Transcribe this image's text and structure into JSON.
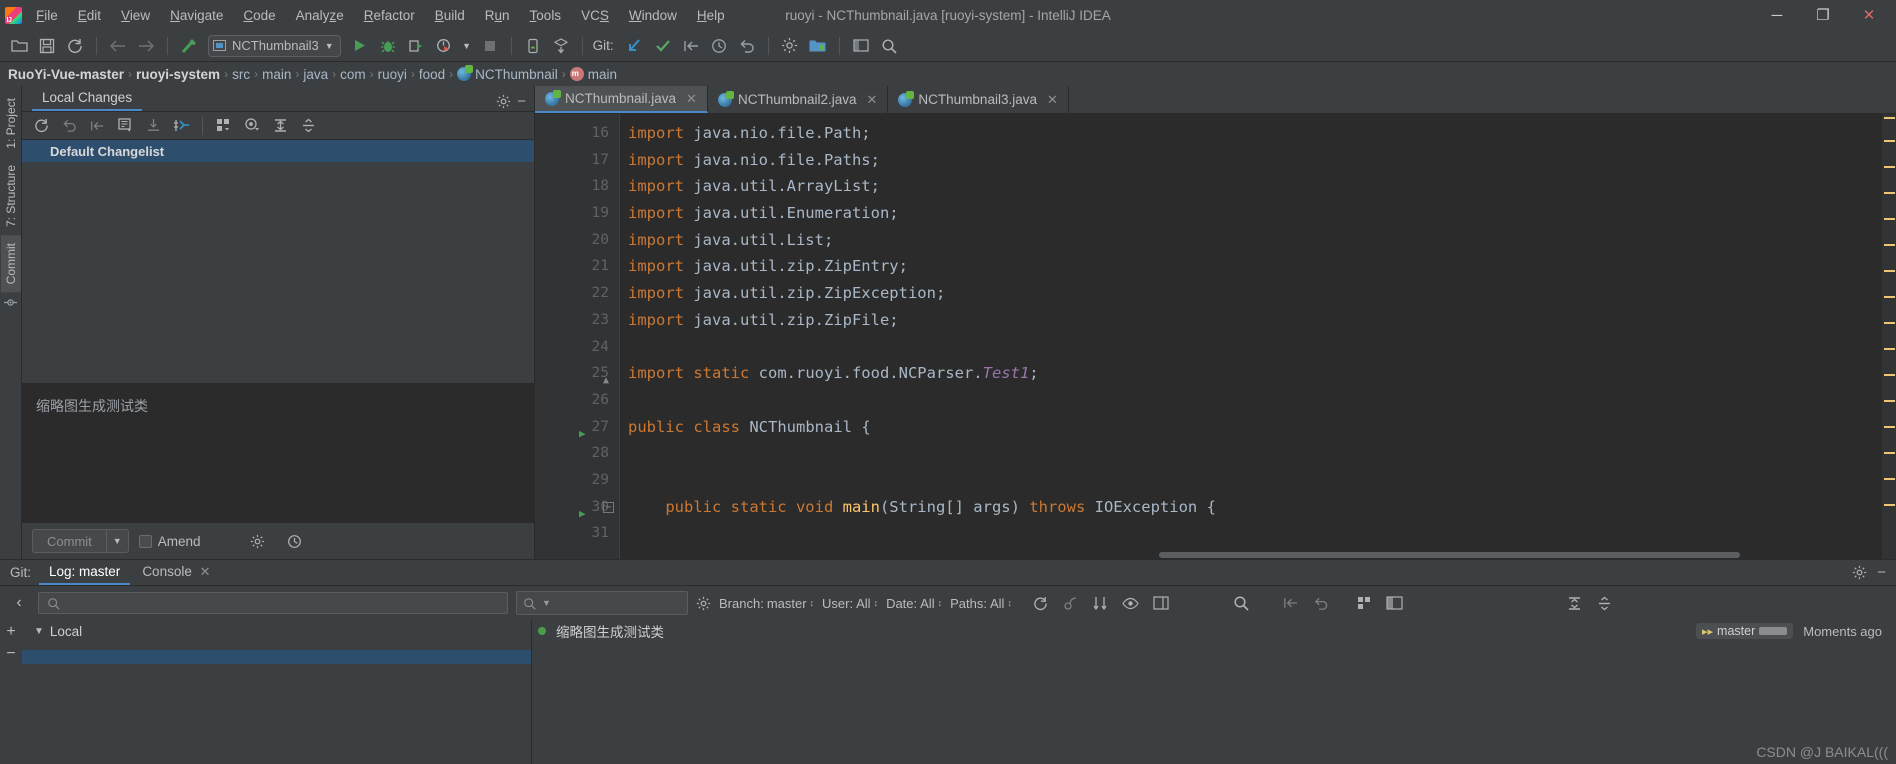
{
  "window": {
    "title": "ruoyi - NCThumbnail.java [ruoyi-system] - IntelliJ IDEA",
    "minimize": "─",
    "maximize": "❐",
    "close": "✕"
  },
  "menu": {
    "items": [
      "File",
      "Edit",
      "View",
      "Navigate",
      "Code",
      "Analyze",
      "Refactor",
      "Build",
      "Run",
      "Tools",
      "VCS",
      "Window",
      "Help"
    ]
  },
  "toolbar": {
    "run_config": "NCThumbnail3",
    "git_label": "Git:",
    "icons": [
      "open-folder-icon",
      "save-all-icon",
      "sync-icon",
      "back-icon",
      "forward-icon",
      "build-icon"
    ]
  },
  "breadcrumb": {
    "items": [
      {
        "label": "RuoYi-Vue-master",
        "bold": true,
        "icon": ""
      },
      {
        "label": "ruoyi-system",
        "bold": true,
        "icon": ""
      },
      {
        "label": "src",
        "bold": false,
        "icon": ""
      },
      {
        "label": "main",
        "bold": false,
        "icon": ""
      },
      {
        "label": "java",
        "bold": false,
        "icon": ""
      },
      {
        "label": "com",
        "bold": false,
        "icon": ""
      },
      {
        "label": "ruoyi",
        "bold": false,
        "icon": ""
      },
      {
        "label": "food",
        "bold": false,
        "icon": ""
      },
      {
        "label": "NCThumbnail",
        "bold": false,
        "icon": "class-icon"
      },
      {
        "label": "main",
        "bold": false,
        "icon": "method-icon"
      }
    ],
    "separator": "›"
  },
  "left_strip": {
    "tabs": [
      "1: Project",
      "7: Structure"
    ],
    "commit_tab": "Commit"
  },
  "local_changes": {
    "tab_label": "Local Changes",
    "changelist": "Default Changelist",
    "commit_message": "缩略图生成测试类",
    "commit_button": "Commit",
    "amend_label": "Amend",
    "toolbar_icons": [
      "refresh-icon",
      "rollback-icon",
      "shelve-icon",
      "diff-icon",
      "download-icon",
      "move-to-changelist-icon",
      "group-by-icon",
      "preview-icon",
      "expand-all-icon",
      "collapse-all-icon"
    ]
  },
  "editor": {
    "tabs": [
      {
        "label": "NCThumbnail.java",
        "active": true,
        "closable": true
      },
      {
        "label": "NCThumbnail2.java",
        "active": false,
        "closable": true
      },
      {
        "label": "NCThumbnail3.java",
        "active": false,
        "closable": true
      }
    ],
    "first_line_number": 16,
    "lines": [
      {
        "n": 16,
        "tokens": [
          {
            "t": "import ",
            "c": "kw"
          },
          {
            "t": "java.nio.file.Path;",
            "c": "pl"
          }
        ]
      },
      {
        "n": 17,
        "tokens": [
          {
            "t": "import ",
            "c": "kw"
          },
          {
            "t": "java.nio.file.Paths;",
            "c": "pl"
          }
        ]
      },
      {
        "n": 18,
        "tokens": [
          {
            "t": "import ",
            "c": "kw"
          },
          {
            "t": "java.util.ArrayList;",
            "c": "pl"
          }
        ]
      },
      {
        "n": 19,
        "tokens": [
          {
            "t": "import ",
            "c": "kw"
          },
          {
            "t": "java.util.Enumeration;",
            "c": "pl"
          }
        ]
      },
      {
        "n": 20,
        "tokens": [
          {
            "t": "import ",
            "c": "kw"
          },
          {
            "t": "java.util.List;",
            "c": "pl"
          }
        ]
      },
      {
        "n": 21,
        "tokens": [
          {
            "t": "import ",
            "c": "kw"
          },
          {
            "t": "java.util.zip.ZipEntry;",
            "c": "pl"
          }
        ]
      },
      {
        "n": 22,
        "tokens": [
          {
            "t": "import ",
            "c": "kw"
          },
          {
            "t": "java.util.zip.ZipException;",
            "c": "pl"
          }
        ]
      },
      {
        "n": 23,
        "tokens": [
          {
            "t": "import ",
            "c": "kw"
          },
          {
            "t": "java.util.zip.ZipFile;",
            "c": "pl"
          }
        ]
      },
      {
        "n": 24,
        "tokens": []
      },
      {
        "n": 25,
        "tokens": [
          {
            "t": "import static ",
            "c": "kw"
          },
          {
            "t": "com.ruoyi.food.NCParser.",
            "c": "pl"
          },
          {
            "t": "Test1",
            "c": "it"
          },
          {
            "t": ";",
            "c": "pl"
          }
        ],
        "fold": true
      },
      {
        "n": 26,
        "tokens": []
      },
      {
        "n": 27,
        "tokens": [
          {
            "t": "public class ",
            "c": "kw"
          },
          {
            "t": "NCThumbnail ",
            "c": "cls"
          },
          {
            "t": "{",
            "c": "pl"
          }
        ],
        "run": true
      },
      {
        "n": 28,
        "tokens": []
      },
      {
        "n": 29,
        "tokens": []
      },
      {
        "n": 30,
        "tokens": [
          {
            "t": "    public static void ",
            "c": "kw"
          },
          {
            "t": "main",
            "c": "mth"
          },
          {
            "t": "(String[] args) ",
            "c": "pl"
          },
          {
            "t": "throws ",
            "c": "kw"
          },
          {
            "t": "IOException {",
            "c": "pl"
          }
        ],
        "run": true,
        "foldminus": true
      },
      {
        "n": 31,
        "tokens": []
      }
    ]
  },
  "bottom": {
    "group_label": "Git:",
    "tabs": [
      {
        "label": "Log: master",
        "active": true,
        "closable": false
      },
      {
        "label": "Console",
        "active": false,
        "closable": true
      }
    ],
    "search_placeholder": "",
    "text_search_placeholder": "",
    "filters": [
      {
        "label": "Branch:",
        "value": "master"
      },
      {
        "label": "User:",
        "value": "All"
      },
      {
        "label": "Date:",
        "value": "All"
      },
      {
        "label": "Paths:",
        "value": "All"
      }
    ],
    "branch_tree": {
      "root": "Local",
      "expand_icon": "▼"
    },
    "commits": [
      {
        "message": "缩略图生成测试类",
        "branch": "master",
        "when": "Moments ago"
      }
    ],
    "watermark": "CSDN @J BAIKAL(((",
    "action_icons": [
      "refresh-icon",
      "cherry-pick-icon",
      "sort-icon",
      "preview-icon",
      "intellisort-icon",
      "search-icon",
      "undo-icon",
      "redo-icon",
      "show-details-icon",
      "layout-icon",
      "collapse-icon",
      "settings-icon",
      "hide-icon"
    ]
  }
}
